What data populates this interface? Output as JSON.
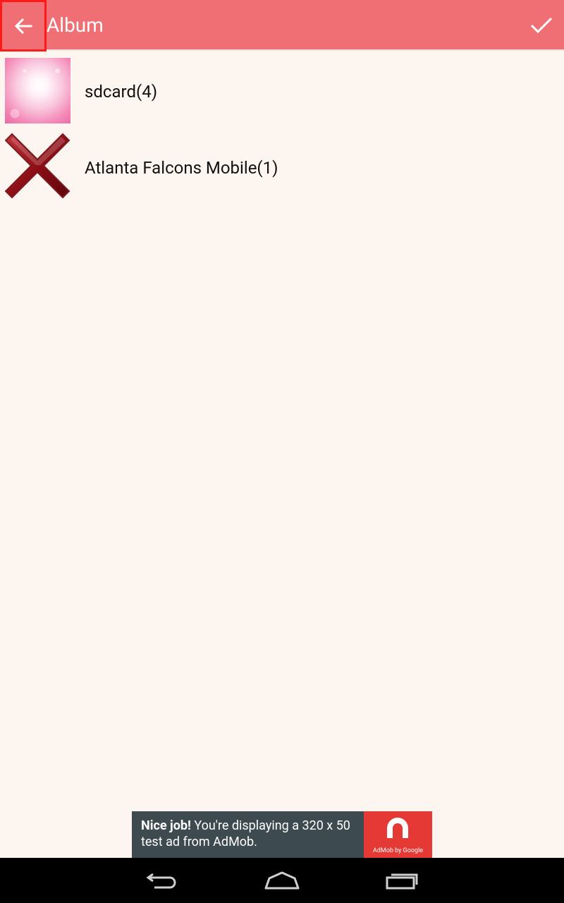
{
  "app_bar": {
    "title": "Album",
    "back_icon": "arrow-left-icon",
    "confirm_icon": "checkmark-icon",
    "color": "#f06f74"
  },
  "albums": [
    {
      "label": "sdcard(4)",
      "thumbnail": "pink-bokeh-image"
    },
    {
      "label": "Atlanta Falcons Mobile(1)",
      "thumbnail": "red-x-image"
    }
  ],
  "ad": {
    "headline": "Nice job!",
    "body": " You're displaying a 320 x 50 test ad from AdMob.",
    "logo_caption": "AdMob by Google"
  },
  "nav": {
    "back_icon": "nav-back-icon",
    "home_icon": "nav-home-icon",
    "recents_icon": "nav-recents-icon"
  }
}
